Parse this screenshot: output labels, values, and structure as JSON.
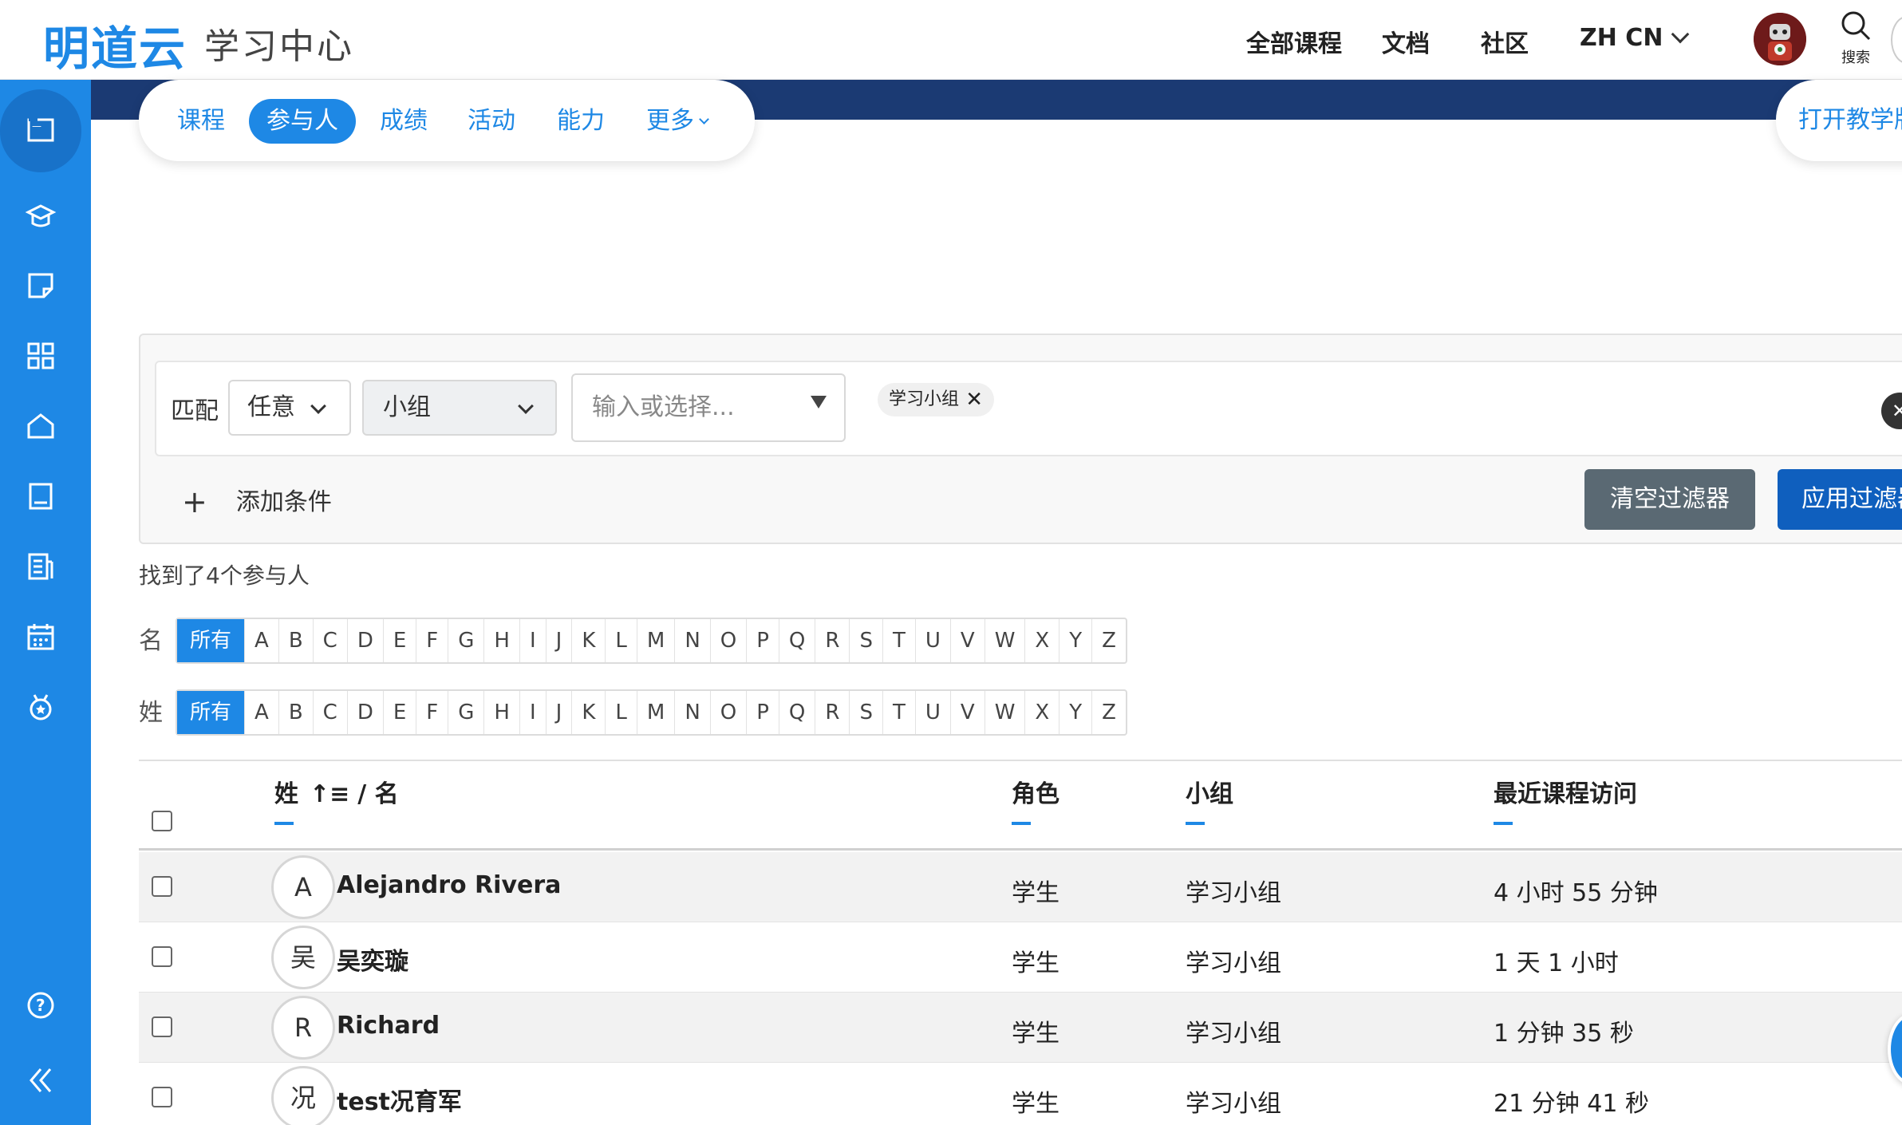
{
  "header": {
    "logo": "明道云",
    "subtitle": "学习中心",
    "nav": [
      "全部课程",
      "文档",
      "社区"
    ],
    "lang": "ZH CN",
    "search_label": "搜索"
  },
  "tabs": {
    "items": [
      "课程",
      "参与人",
      "成绩",
      "活动",
      "能力"
    ],
    "more": "更多",
    "active": "参与人",
    "open_teaching": "打开教学版"
  },
  "filter": {
    "match_label": "匹配",
    "match_value": "任意",
    "field_value": "小组",
    "input_placeholder": "输入或选择...",
    "chip": "学习小组",
    "add_condition": "添加条件",
    "clear_button": "清空过滤器",
    "apply_button": "应用过滤器"
  },
  "found_text": "找到了4个参与人",
  "letter_bars": {
    "first_label": "名",
    "last_label": "姓",
    "all": "所有",
    "letters": [
      "A",
      "B",
      "C",
      "D",
      "E",
      "F",
      "G",
      "H",
      "I",
      "J",
      "K",
      "L",
      "M",
      "N",
      "O",
      "P",
      "Q",
      "R",
      "S",
      "T",
      "U",
      "V",
      "W",
      "X",
      "Y",
      "Z"
    ]
  },
  "table": {
    "columns": {
      "name": "姓",
      "name_rest": "/ 名",
      "role": "角色",
      "group": "小组",
      "last_access": "最近课程访问"
    },
    "rows": [
      {
        "initial": "A",
        "name": "Alejandro Rivera",
        "role": "学生",
        "group": "学习小组",
        "last_access": "4 小时 55 分钟"
      },
      {
        "initial": "吴",
        "name": "吴奕璇",
        "role": "学生",
        "group": "学习小组",
        "last_access": "1 天 1 小时"
      },
      {
        "initial": "R",
        "name": "Richard",
        "role": "学生",
        "group": "学习小组",
        "last_access": "1 分钟 35 秒"
      },
      {
        "initial": "况",
        "name": "test况育军",
        "role": "学生",
        "group": "学习小组",
        "last_access": "21 分钟 41 秒"
      }
    ]
  },
  "colors": {
    "primary": "#1e88e5",
    "band": "#1b3a73",
    "apply": "#0f5fbe",
    "clear": "#5a6973"
  },
  "sidebar_icons": [
    "course-index-icon",
    "graduation-cap-icon",
    "note-icon",
    "dashboard-icon",
    "home-icon",
    "book-icon",
    "report-icon",
    "calendar-icon",
    "badge-icon",
    "help-icon",
    "collapse-icon"
  ]
}
